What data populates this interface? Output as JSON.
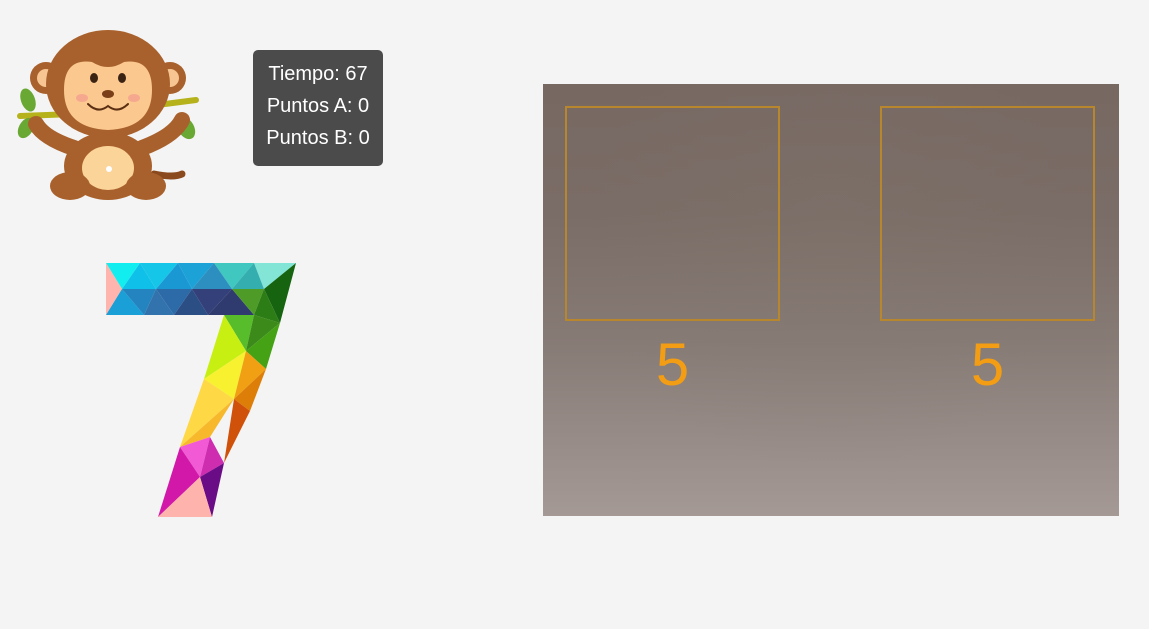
{
  "stats": {
    "time_label": "Tiempo: 67",
    "points_a_label": "Puntos A: 0",
    "points_b_label": "Puntos B: 0"
  },
  "target_number": {
    "value": "7",
    "icon": "polygonal-number-seven"
  },
  "mascot": {
    "icon": "monkey-icon"
  },
  "camera": {
    "zones": [
      {
        "value": "5"
      },
      {
        "value": "5"
      }
    ],
    "zone_border_color": "#b8862d",
    "zone_number_color": "#f29d13"
  },
  "colors": {
    "stats_bg": "#4b4b4b",
    "page_bg": "#f4f4f4"
  }
}
